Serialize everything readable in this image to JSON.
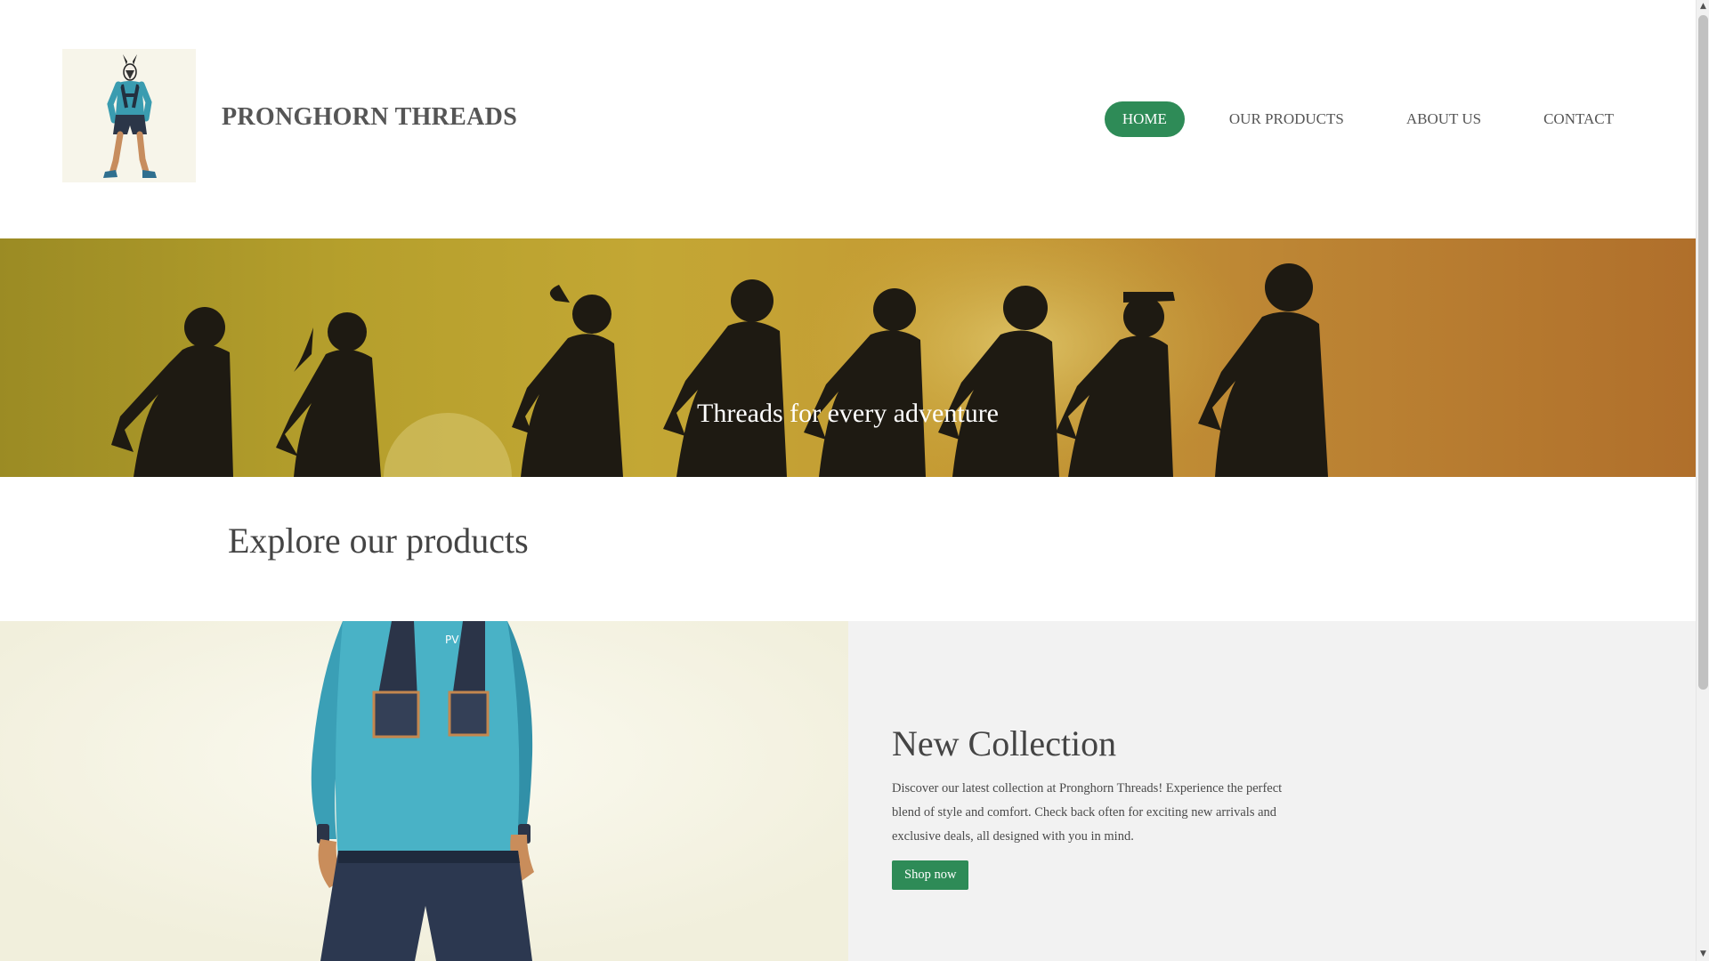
{
  "header": {
    "brand": "PRONGHORN THREADS",
    "nav": [
      {
        "label": "HOME",
        "active": true
      },
      {
        "label": "OUR PRODUCTS",
        "active": false
      },
      {
        "label": "ABOUT US",
        "active": false
      },
      {
        "label": "CONTACT",
        "active": false
      }
    ]
  },
  "hero": {
    "tagline": "Threads for every adventure"
  },
  "explore": {
    "title": "Explore our products"
  },
  "featured": {
    "title": "New Collection",
    "description": "Discover our latest collection at Pronghorn Threads! Experience the perfect blend of style and comfort. Check back often for exciting new arrivals and exclusive deals, all designed with you in mind.",
    "button_label": "Shop now"
  },
  "colors": {
    "accent": "#2e8b57",
    "text": "#555555",
    "panel": "#f2f2f2"
  }
}
